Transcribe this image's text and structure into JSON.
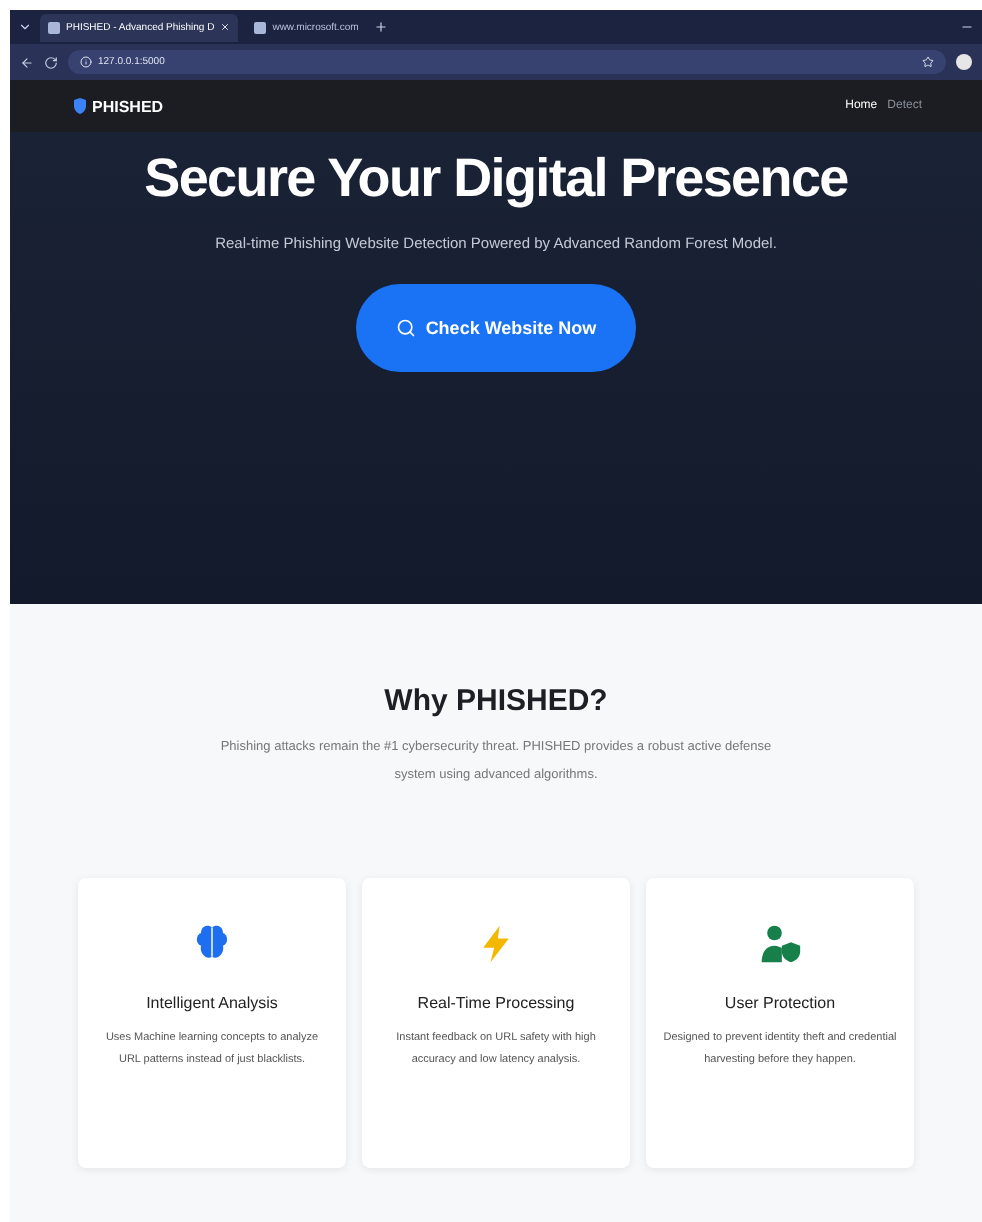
{
  "browser": {
    "tabs": [
      {
        "title": "PHISHED - Advanced Phishing D",
        "selected": true
      },
      {
        "title": "www.microsoft.com",
        "selected": false
      }
    ],
    "address": "127.0.0.1:5000"
  },
  "nav": {
    "brand": "PHISHED",
    "links": [
      {
        "label": "Home",
        "selected": true
      },
      {
        "label": "Detect",
        "selected": false
      }
    ]
  },
  "hero": {
    "title": "Secure Your Digital Presence",
    "subtitle": "Real-time Phishing Website Detection Powered by Advanced Random Forest Model.",
    "button": "Check Website Now"
  },
  "why": {
    "title": "Why PHISHED?",
    "text": "Phishing attacks remain the #1 cybersecurity threat. PHISHED provides a robust active defense system using advanced algorithms."
  },
  "features": [
    {
      "kind": "brain",
      "color": "#1e6ff0",
      "title": "Intelligent Analysis",
      "text": "Uses Machine learning concepts to analyze URL patterns instead of just blacklists."
    },
    {
      "kind": "bolt",
      "color": "#f5b800",
      "title": "Real-Time Processing",
      "text": "Instant feedback on URL safety with high accuracy and low latency analysis."
    },
    {
      "kind": "user-shield",
      "color": "#17804a",
      "title": "User Protection",
      "text": "Designed to prevent identity theft and credential harvesting before they happen."
    }
  ]
}
